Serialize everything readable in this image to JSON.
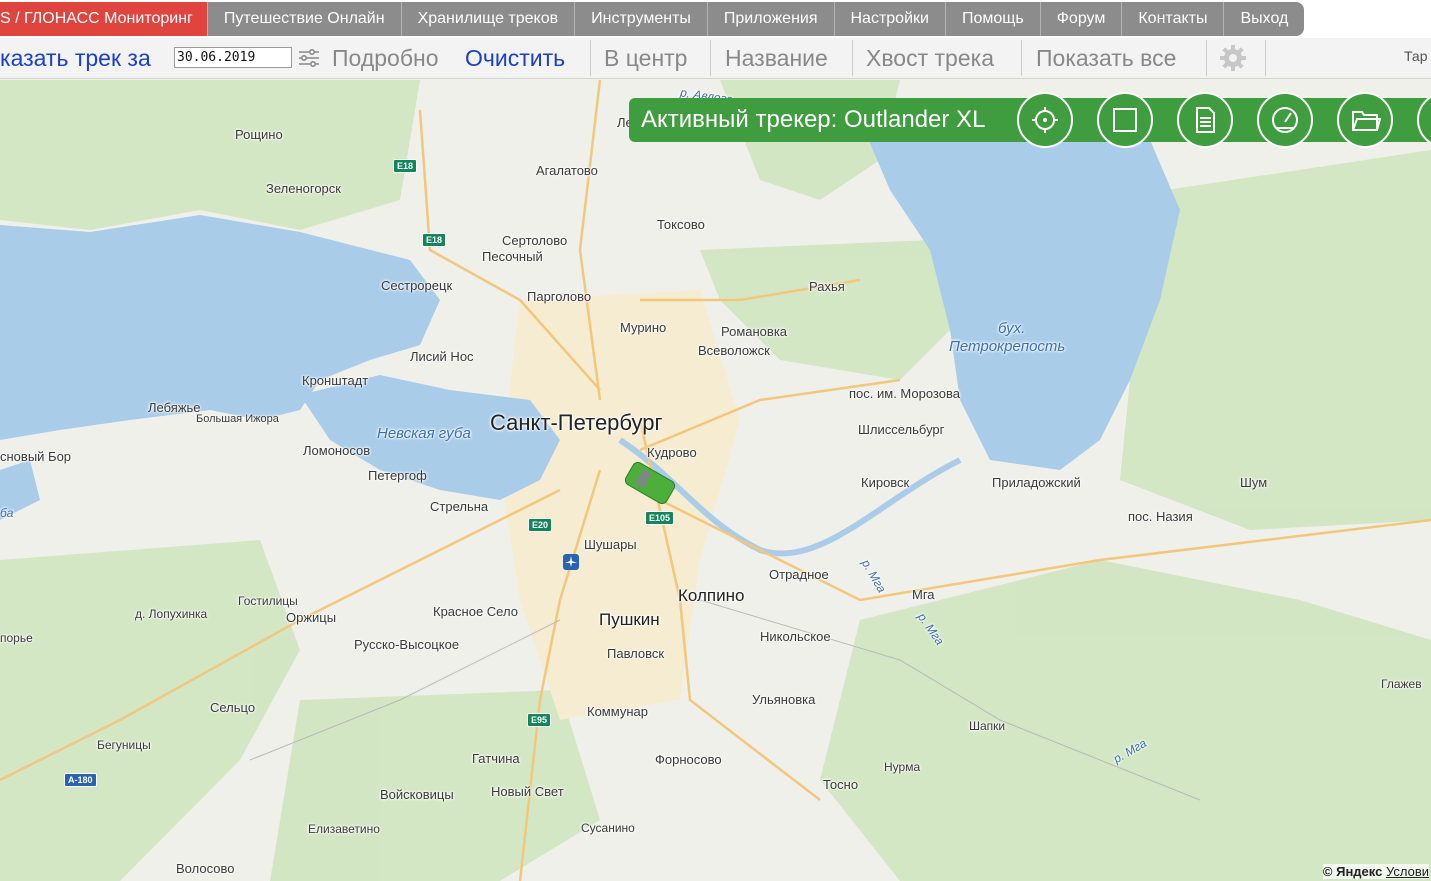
{
  "nav": {
    "brand": "S / ГЛОНАСС Мониторинг",
    "items": [
      "Путешествие Онлайн",
      "Хранилище треков",
      "Инструменты",
      "Приложения",
      "Настройки",
      "Помощь",
      "Форум",
      "Контакты",
      "Выход"
    ]
  },
  "toolbar": {
    "show_track": "казать трек за",
    "date": "30.06.2019",
    "details": "Подробно",
    "clear": "Очистить",
    "center": "В центр",
    "name": "Название",
    "tail": "Хвост трека",
    "show_all": "Показать все",
    "tar": "Тар"
  },
  "tracker": {
    "title": "Активный трекер: Outlander XL"
  },
  "map": {
    "labels": {
      "roshchino": "Рощино",
      "zelenogorsk": "Зеленогорск",
      "agalatovo": "Агалатово",
      "toksovo": "Токсово",
      "sertolovo": "Сертолово",
      "pesochny": "Песочный",
      "sestroretsk": "Сестрорецк",
      "pargolovo": "Парголово",
      "rakhya": "Рахья",
      "murino": "Мурино",
      "romanovka": "Романовка",
      "vsevolozhsk": "Всеволожск",
      "lisiy_nos": "Лисий Нос",
      "kronshtadt": "Кронштадт",
      "morozova": "пос. им. Морозова",
      "lebyazhye": "Лебяжье",
      "bolshaya_izhora": "Большая Ижора",
      "spb": "Санкт-Петербург",
      "nevskaya": "Невская губа",
      "shlisselburg": "Шлиссельбург",
      "lomonosov": "Ломоносов",
      "sosnovy_bor": "сновый Бор",
      "kudrovo": "Кудрово",
      "peterhof": "Петергоф",
      "kirovsk": "Кировск",
      "prilad": "Приладожский",
      "shum": "Шум",
      "strelna": "Стрельна",
      "nazia": "пос. Назия",
      "shushary": "Шушары",
      "otradnoe": "Отрадное",
      "kolpino": "Колпино",
      "mga": "Мга",
      "gostilitsy": "Гостилицы",
      "lopukhinka": "д. Лопухинка",
      "orzhitsy": "Оржицы",
      "krasnoe": "Красное Село",
      "pushkin": "Пушкин",
      "nikolskoe": "Никольское",
      "koporye": "порье",
      "russko": "Русско-Высоцкое",
      "pavlovsk": "Павловск",
      "ulyanovka": "Ульяновка",
      "glazhevo": "Глажев",
      "selco": "Сельцо",
      "kommunar": "Коммунар",
      "shapki": "Шапки",
      "begunitsy": "Бегуницы",
      "gatchina": "Гатчина",
      "fornosovo": "Форносово",
      "nurma": "Нурма",
      "tosno": "Тосно",
      "voiskovitsy": "Войсковицы",
      "novy_svet": "Новый Свет",
      "elizavetino": "Елизаветино",
      "susanino": "Сусанино",
      "volosovo": "Волосово",
      "bukh": "бух.",
      "petrokrepost": "Петрокрепость",
      "r_mga1": "р. Мга",
      "r_mga2": "р. Мга",
      "r_mga3": "р. Мга",
      "r_avloga": "р. Авлога",
      "le": "Ле",
      "ba": "ба"
    },
    "shields": {
      "e18a": "E18",
      "e18b": "E18",
      "e20": "E20",
      "e105": "E105",
      "e95": "E95",
      "a180": "A-180"
    },
    "copyright": "© Яндекс",
    "terms": "Услови"
  }
}
